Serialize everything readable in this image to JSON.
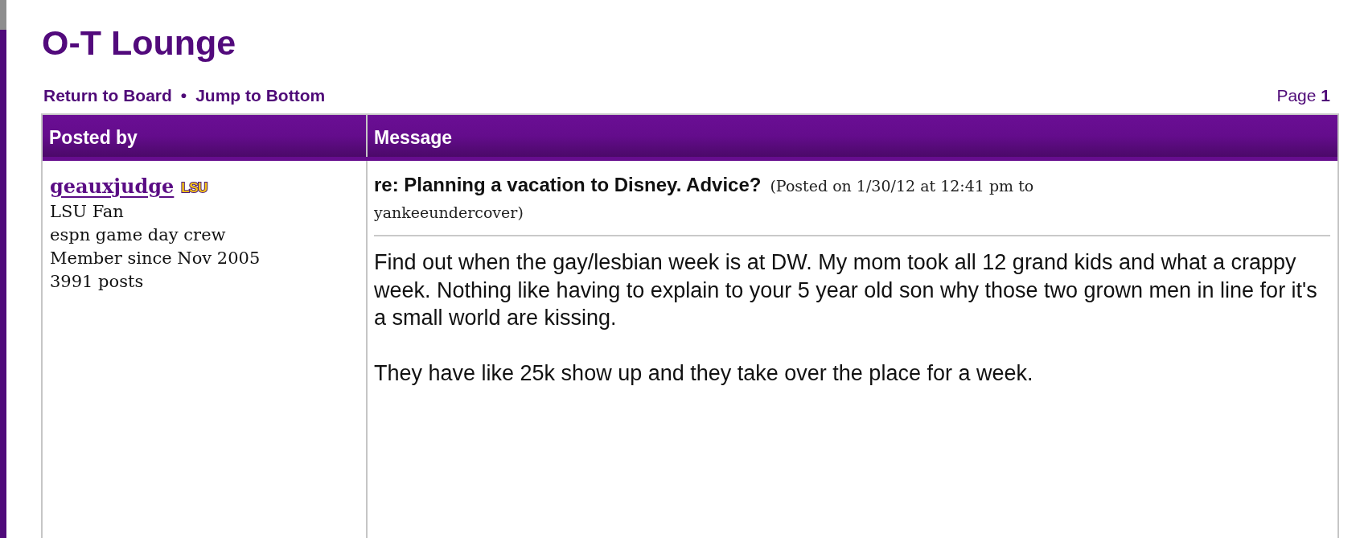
{
  "forum": {
    "title": "O-T Lounge"
  },
  "nav": {
    "links": [
      {
        "label": "Return to Board"
      },
      {
        "label": "Jump to Bottom"
      }
    ],
    "separator": "•",
    "page": "Page **1**"
  },
  "table": {
    "columns": [
      "Posted by",
      "Message"
    ]
  },
  "post": {
    "author": {
      "username": "geauxjudge",
      "team_logo": "LSU",
      "details": [
        "LSU Fan",
        "espn game day crew",
        "Member since Nov 2005",
        "3991 posts"
      ]
    },
    "subject": "re: Planning a vacation to Disney. Advice?",
    "posted_info": "(Posted on 1/30/12 at 12:41 pm to yankeeundercover)",
    "body": [
      "Find out when the gay/lesbian week is at DW. My mom took all 12 grand kids and what a crappy week. Nothing like having to explain to your 5 year old son why those two grown men in line for it's a small world are kissing.",
      "They have like 25k show up and they take over the place for a week."
    ]
  }
}
